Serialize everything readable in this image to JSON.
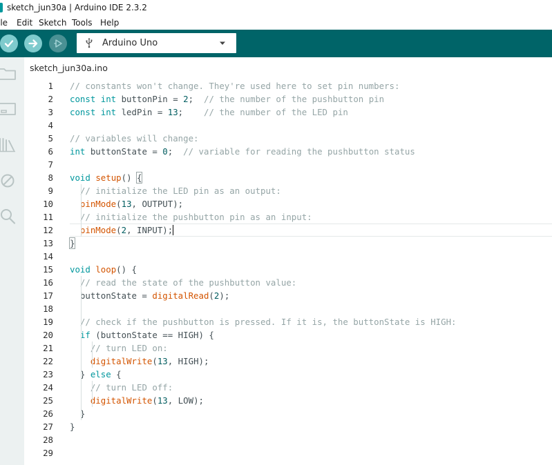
{
  "window": {
    "title": "sketch_jun30a | Arduino IDE 2.3.2"
  },
  "menu": [
    "ile",
    "Edit",
    "Sketch",
    "Tools",
    "Help"
  ],
  "toolbar": {
    "verify_icon": "check-icon",
    "upload_icon": "arrow-right-icon",
    "debug_icon": "debug-icon",
    "board": "Arduino Uno",
    "colors": {
      "toolbar_bg": "#006468",
      "button_bg": "#7fcbcd",
      "button_disabled_bg": "#4a9194"
    }
  },
  "sidebar": {
    "items": [
      "sketchbook-icon",
      "boards-manager-icon",
      "library-manager-icon",
      "debug-disabled-icon",
      "search-icon"
    ]
  },
  "tabs": [
    {
      "label": "sketch_jun30a.ino",
      "active": true
    }
  ],
  "editor": {
    "current_line": 12,
    "lines": [
      {
        "n": "1",
        "tokens": [
          [
            "c",
            "// constants won't change. They're used here to set pin numbers:"
          ]
        ]
      },
      {
        "n": "2",
        "tokens": [
          [
            "k",
            "const int"
          ],
          [
            "p",
            " buttonPin = "
          ],
          [
            "m",
            "2"
          ],
          [
            "p",
            ";  "
          ],
          [
            "c",
            "// the number of the pushbutton pin"
          ]
        ]
      },
      {
        "n": "3",
        "tokens": [
          [
            "k",
            "const int"
          ],
          [
            "p",
            " ledPin = "
          ],
          [
            "m",
            "13"
          ],
          [
            "p",
            ";    "
          ],
          [
            "c",
            "// the number of the LED pin"
          ]
        ]
      },
      {
        "n": "4",
        "tokens": []
      },
      {
        "n": "5",
        "tokens": [
          [
            "c",
            "// variables will change:"
          ]
        ]
      },
      {
        "n": "6",
        "tokens": [
          [
            "k",
            "int"
          ],
          [
            "p",
            " buttonState = "
          ],
          [
            "m",
            "0"
          ],
          [
            "p",
            ";  "
          ],
          [
            "c",
            "// variable for reading the pushbutton status"
          ]
        ]
      },
      {
        "n": "7",
        "tokens": []
      },
      {
        "n": "8",
        "tokens": [
          [
            "k",
            "void"
          ],
          [
            "p",
            " "
          ],
          [
            "f",
            "setup"
          ],
          [
            "p",
            "() "
          ],
          [
            "b",
            "{"
          ]
        ]
      },
      {
        "n": "9",
        "tokens": [
          [
            "p",
            "  "
          ],
          [
            "c",
            "// initialize the LED pin as an output:"
          ]
        ]
      },
      {
        "n": "10",
        "tokens": [
          [
            "p",
            "  "
          ],
          [
            "f",
            "pinMode"
          ],
          [
            "p",
            "("
          ],
          [
            "m",
            "13"
          ],
          [
            "p",
            ", OUTPUT);"
          ]
        ]
      },
      {
        "n": "11",
        "tokens": [
          [
            "p",
            "  "
          ],
          [
            "c",
            "// initialize the pushbutton pin as an input:"
          ]
        ]
      },
      {
        "n": "12",
        "tokens": [
          [
            "p",
            "  "
          ],
          [
            "f",
            "pinMode"
          ],
          [
            "p",
            "("
          ],
          [
            "m",
            "2"
          ],
          [
            "p",
            ", INPUT);"
          ],
          [
            "cur",
            ""
          ]
        ]
      },
      {
        "n": "13",
        "tokens": [
          [
            "b",
            "}"
          ]
        ]
      },
      {
        "n": "14",
        "tokens": []
      },
      {
        "n": "15",
        "tokens": [
          [
            "k",
            "void"
          ],
          [
            "p",
            " "
          ],
          [
            "f",
            "loop"
          ],
          [
            "p",
            "() {"
          ]
        ]
      },
      {
        "n": "16",
        "tokens": [
          [
            "p",
            "  "
          ],
          [
            "c",
            "// read the state of the pushbutton value:"
          ]
        ]
      },
      {
        "n": "17",
        "tokens": [
          [
            "p",
            "  buttonState = "
          ],
          [
            "f",
            "digitalRead"
          ],
          [
            "p",
            "("
          ],
          [
            "m",
            "2"
          ],
          [
            "p",
            ");"
          ]
        ]
      },
      {
        "n": "18",
        "tokens": []
      },
      {
        "n": "19",
        "tokens": [
          [
            "p",
            "  "
          ],
          [
            "c",
            "// check if the pushbutton is pressed. If it is, the buttonState is HIGH:"
          ]
        ]
      },
      {
        "n": "20",
        "tokens": [
          [
            "p",
            "  "
          ],
          [
            "k",
            "if"
          ],
          [
            "p",
            " (buttonState == HIGH) {"
          ]
        ]
      },
      {
        "n": "21",
        "tokens": [
          [
            "p",
            "    "
          ],
          [
            "c",
            "// turn LED on:"
          ]
        ]
      },
      {
        "n": "22",
        "tokens": [
          [
            "p",
            "    "
          ],
          [
            "f",
            "digitalWrite"
          ],
          [
            "p",
            "("
          ],
          [
            "m",
            "13"
          ],
          [
            "p",
            ", HIGH);"
          ]
        ]
      },
      {
        "n": "23",
        "tokens": [
          [
            "p",
            "  } "
          ],
          [
            "k",
            "else"
          ],
          [
            "p",
            " {"
          ]
        ]
      },
      {
        "n": "24",
        "tokens": [
          [
            "p",
            "    "
          ],
          [
            "c",
            "// turn LED off:"
          ]
        ]
      },
      {
        "n": "25",
        "tokens": [
          [
            "p",
            "    "
          ],
          [
            "f",
            "digitalWrite"
          ],
          [
            "p",
            "("
          ],
          [
            "m",
            "13"
          ],
          [
            "p",
            ", LOW);"
          ]
        ]
      },
      {
        "n": "26",
        "tokens": [
          [
            "p",
            "  }"
          ]
        ]
      },
      {
        "n": "27",
        "tokens": [
          [
            "p",
            "}"
          ]
        ]
      },
      {
        "n": "28",
        "tokens": []
      },
      {
        "n": "29",
        "tokens": []
      }
    ]
  }
}
